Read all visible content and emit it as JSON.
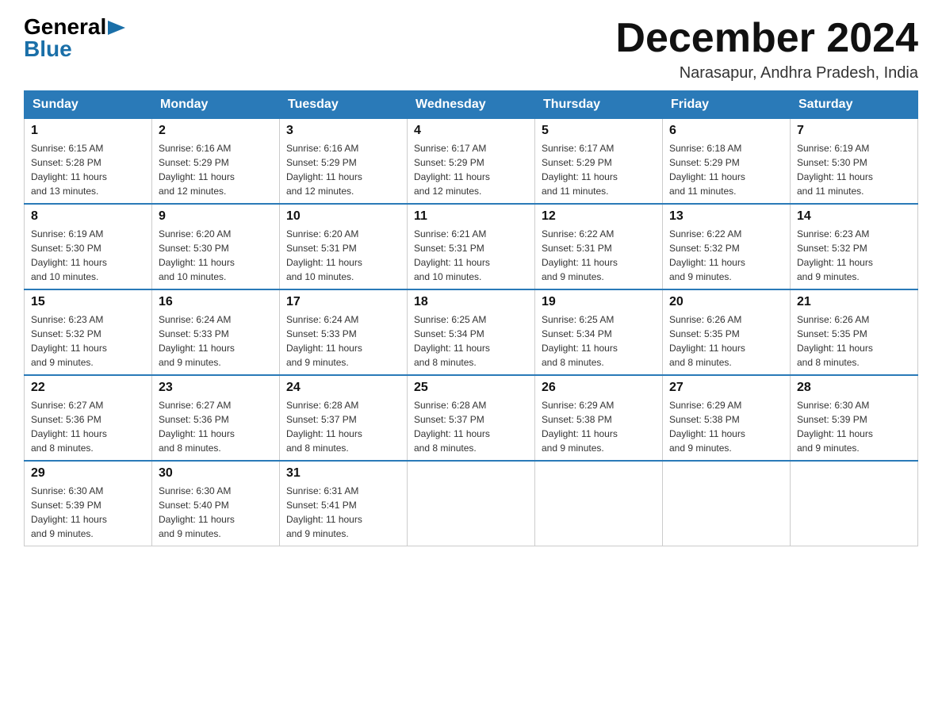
{
  "header": {
    "logo": {
      "general": "General",
      "arrow": "▶",
      "blue": "Blue"
    },
    "title": "December 2024",
    "location": "Narasapur, Andhra Pradesh, India"
  },
  "days_of_week": [
    "Sunday",
    "Monday",
    "Tuesday",
    "Wednesday",
    "Thursday",
    "Friday",
    "Saturday"
  ],
  "weeks": [
    {
      "days": [
        {
          "num": "1",
          "sunrise": "6:15 AM",
          "sunset": "5:28 PM",
          "daylight": "11 hours and 13 minutes."
        },
        {
          "num": "2",
          "sunrise": "6:16 AM",
          "sunset": "5:29 PM",
          "daylight": "11 hours and 12 minutes."
        },
        {
          "num": "3",
          "sunrise": "6:16 AM",
          "sunset": "5:29 PM",
          "daylight": "11 hours and 12 minutes."
        },
        {
          "num": "4",
          "sunrise": "6:17 AM",
          "sunset": "5:29 PM",
          "daylight": "11 hours and 12 minutes."
        },
        {
          "num": "5",
          "sunrise": "6:17 AM",
          "sunset": "5:29 PM",
          "daylight": "11 hours and 11 minutes."
        },
        {
          "num": "6",
          "sunrise": "6:18 AM",
          "sunset": "5:29 PM",
          "daylight": "11 hours and 11 minutes."
        },
        {
          "num": "7",
          "sunrise": "6:19 AM",
          "sunset": "5:30 PM",
          "daylight": "11 hours and 11 minutes."
        }
      ]
    },
    {
      "days": [
        {
          "num": "8",
          "sunrise": "6:19 AM",
          "sunset": "5:30 PM",
          "daylight": "11 hours and 10 minutes."
        },
        {
          "num": "9",
          "sunrise": "6:20 AM",
          "sunset": "5:30 PM",
          "daylight": "11 hours and 10 minutes."
        },
        {
          "num": "10",
          "sunrise": "6:20 AM",
          "sunset": "5:31 PM",
          "daylight": "11 hours and 10 minutes."
        },
        {
          "num": "11",
          "sunrise": "6:21 AM",
          "sunset": "5:31 PM",
          "daylight": "11 hours and 10 minutes."
        },
        {
          "num": "12",
          "sunrise": "6:22 AM",
          "sunset": "5:31 PM",
          "daylight": "11 hours and 9 minutes."
        },
        {
          "num": "13",
          "sunrise": "6:22 AM",
          "sunset": "5:32 PM",
          "daylight": "11 hours and 9 minutes."
        },
        {
          "num": "14",
          "sunrise": "6:23 AM",
          "sunset": "5:32 PM",
          "daylight": "11 hours and 9 minutes."
        }
      ]
    },
    {
      "days": [
        {
          "num": "15",
          "sunrise": "6:23 AM",
          "sunset": "5:32 PM",
          "daylight": "11 hours and 9 minutes."
        },
        {
          "num": "16",
          "sunrise": "6:24 AM",
          "sunset": "5:33 PM",
          "daylight": "11 hours and 9 minutes."
        },
        {
          "num": "17",
          "sunrise": "6:24 AM",
          "sunset": "5:33 PM",
          "daylight": "11 hours and 9 minutes."
        },
        {
          "num": "18",
          "sunrise": "6:25 AM",
          "sunset": "5:34 PM",
          "daylight": "11 hours and 8 minutes."
        },
        {
          "num": "19",
          "sunrise": "6:25 AM",
          "sunset": "5:34 PM",
          "daylight": "11 hours and 8 minutes."
        },
        {
          "num": "20",
          "sunrise": "6:26 AM",
          "sunset": "5:35 PM",
          "daylight": "11 hours and 8 minutes."
        },
        {
          "num": "21",
          "sunrise": "6:26 AM",
          "sunset": "5:35 PM",
          "daylight": "11 hours and 8 minutes."
        }
      ]
    },
    {
      "days": [
        {
          "num": "22",
          "sunrise": "6:27 AM",
          "sunset": "5:36 PM",
          "daylight": "11 hours and 8 minutes."
        },
        {
          "num": "23",
          "sunrise": "6:27 AM",
          "sunset": "5:36 PM",
          "daylight": "11 hours and 8 minutes."
        },
        {
          "num": "24",
          "sunrise": "6:28 AM",
          "sunset": "5:37 PM",
          "daylight": "11 hours and 8 minutes."
        },
        {
          "num": "25",
          "sunrise": "6:28 AM",
          "sunset": "5:37 PM",
          "daylight": "11 hours and 8 minutes."
        },
        {
          "num": "26",
          "sunrise": "6:29 AM",
          "sunset": "5:38 PM",
          "daylight": "11 hours and 9 minutes."
        },
        {
          "num": "27",
          "sunrise": "6:29 AM",
          "sunset": "5:38 PM",
          "daylight": "11 hours and 9 minutes."
        },
        {
          "num": "28",
          "sunrise": "6:30 AM",
          "sunset": "5:39 PM",
          "daylight": "11 hours and 9 minutes."
        }
      ]
    },
    {
      "days": [
        {
          "num": "29",
          "sunrise": "6:30 AM",
          "sunset": "5:39 PM",
          "daylight": "11 hours and 9 minutes."
        },
        {
          "num": "30",
          "sunrise": "6:30 AM",
          "sunset": "5:40 PM",
          "daylight": "11 hours and 9 minutes."
        },
        {
          "num": "31",
          "sunrise": "6:31 AM",
          "sunset": "5:41 PM",
          "daylight": "11 hours and 9 minutes."
        },
        null,
        null,
        null,
        null
      ]
    }
  ],
  "labels": {
    "sunrise": "Sunrise:",
    "sunset": "Sunset:",
    "daylight": "Daylight:"
  }
}
